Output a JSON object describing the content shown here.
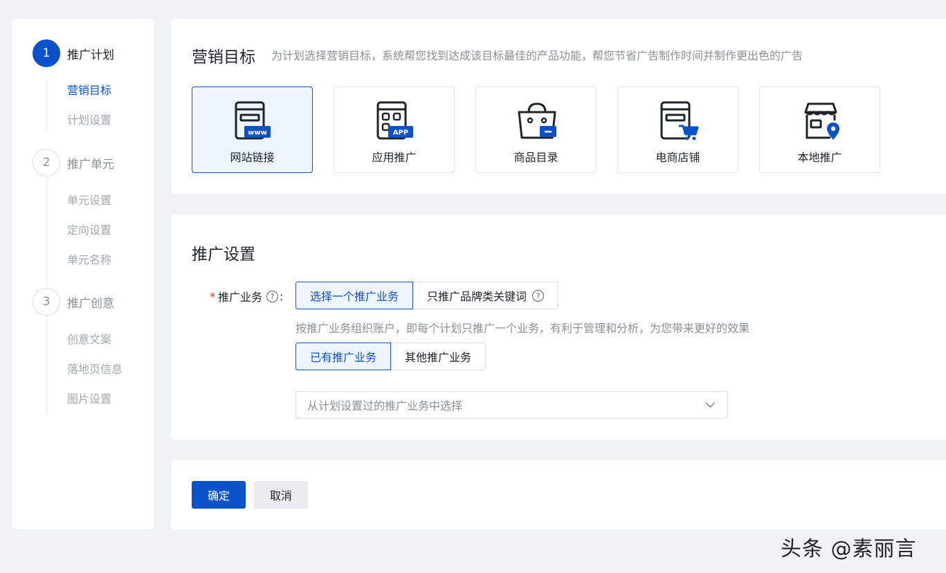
{
  "sidebar": {
    "steps": [
      {
        "num": "1",
        "title": "推广计划",
        "subs": [
          "营销目标",
          "计划设置"
        ]
      },
      {
        "num": "2",
        "title": "推广单元",
        "subs": [
          "单元设置",
          "定向设置",
          "单元名称"
        ]
      },
      {
        "num": "3",
        "title": "推广创意",
        "subs": [
          "创意文案",
          "落地页信息",
          "图片设置"
        ]
      }
    ]
  },
  "goal": {
    "title": "营销目标",
    "desc": "为计划选择营销目标，系统帮您找到达成该目标最佳的产品功能，帮您节省广告制作时间并制作更出色的广告",
    "tiles": [
      {
        "label": "网站链接",
        "icon": "website-www-icon",
        "badge": "www"
      },
      {
        "label": "应用推广",
        "icon": "app-icon",
        "badge": "APP"
      },
      {
        "label": "商品目录",
        "icon": "shopping-bag-icon"
      },
      {
        "label": "电商店铺",
        "icon": "ecommerce-cart-icon"
      },
      {
        "label": "本地推广",
        "icon": "local-store-pin-icon"
      }
    ]
  },
  "settings": {
    "title": "推广设置",
    "field_required_mark": "*",
    "field_label": "推广业务",
    "help_glyph": "?",
    "colon": ":",
    "mode_options": [
      "选择一个推广业务",
      "只推广品牌类关键词"
    ],
    "hint": "按推广业务组织账户，即每个计划只推广一个业务，有利于管理和分析，为您带来更好的效果",
    "source_options": [
      "已有推广业务",
      "其他推广业务"
    ],
    "select_placeholder": "从计划设置过的推广业务中选择"
  },
  "actions": {
    "confirm": "确定",
    "cancel": "取消"
  },
  "watermark": "头条 @素丽言",
  "colors": {
    "primary": "#0a52c8",
    "selected_bg": "#eef4fd",
    "page_bg": "#f0f2f5"
  }
}
